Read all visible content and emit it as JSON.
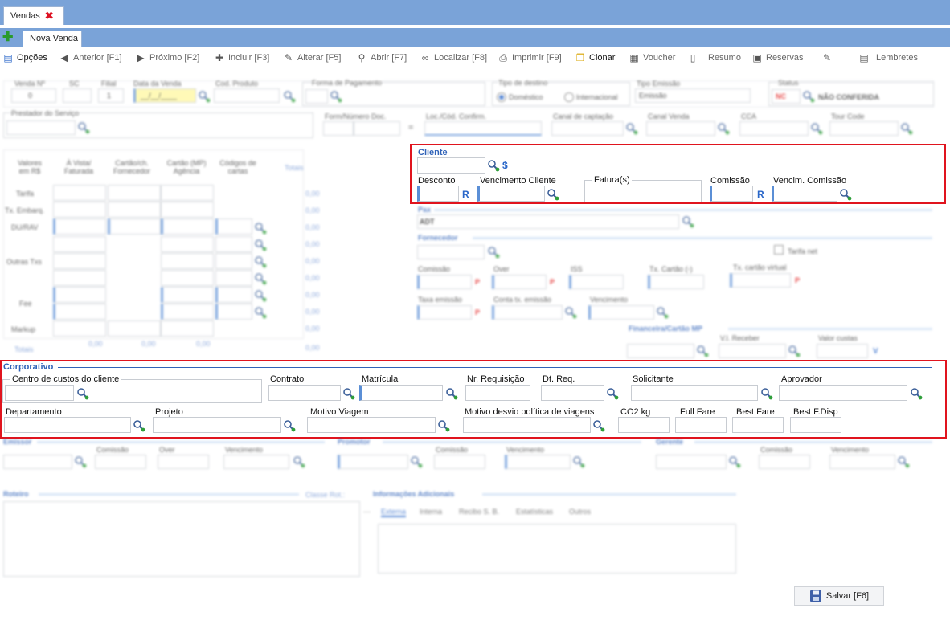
{
  "tabs": {
    "main": "Vendas",
    "sub": "Nova Venda"
  },
  "toolbar": {
    "opcoes": "Opções",
    "anterior": "Anterior [F1]",
    "proximo": "Próximo [F2]",
    "incluir": "Incluir [F3]",
    "alterar": "Alterar [F5]",
    "abrir": "Abrir [F7]",
    "localizar": "Localizar [F8]",
    "imprimir": "Imprimir [F9]",
    "clonar": "Clonar",
    "voucher": "Voucher",
    "resumo": "Resumo",
    "reservas": "Reservas",
    "lembretes": "Lembretes"
  },
  "header": {
    "venda_n": "Venda Nº",
    "venda_n_val": "0",
    "sc": "SC",
    "filial": "Filial",
    "filial_val": "1",
    "data_venda": "Data da Venda",
    "data_venda_val": "__/__/____",
    "cod_produto": "Cod. Produto",
    "forma_pagamento": "Forma de Pagamento",
    "tipo_destino": "Tipo de destino",
    "domestico": "Doméstico",
    "internacional": "Internacional",
    "tipo_emissao": "Tipo Emissão",
    "tipo_emissao_val": "Emissão",
    "status": "Status",
    "status_code": "NC",
    "status_val": "NÃO CONFERIDA",
    "prestador": "Prestador do Serviço",
    "form_numero_doc": "Form/Número Doc.",
    "loc_cod": "Loc./Cód. Confirm.",
    "canal_captacao": "Canal de captação",
    "canal_venda": "Canal Venda",
    "cca": "CCA",
    "tour_code": "Tour Code"
  },
  "valores": {
    "col1": "Valores em R$",
    "col2": "À Vista/ Faturada",
    "col3": "Cartão/ch. Fornecedor",
    "col4": "Cartão (MP) Agência",
    "col5": "Códigos de cartas",
    "totais": "Totais",
    "rows": [
      "Tarifa",
      "Tx. Embarq.",
      "DU/RAV",
      "Outras Txs",
      "Fee",
      "Markup"
    ],
    "row_totais": "Totais",
    "zero": "0,00",
    "totais_vals": [
      "0,00",
      "0,00",
      "0,00"
    ]
  },
  "cliente": {
    "title": "Cliente",
    "desconto": "Desconto",
    "vencimento_cliente": "Vencimento Cliente",
    "faturas": "Fatura(s)",
    "comissao": "Comissão",
    "vencim_comissao": "Vencim. Comissão",
    "letter_r": "R",
    "dollar": "$"
  },
  "pax": {
    "title": "Pax",
    "value": "ADT"
  },
  "fornecedor": {
    "title": "Fornecedor",
    "tarifa_net": "Tarifa net",
    "comissao": "Comissão",
    "over": "Over",
    "iss": "ISS",
    "tx_cartao": "Tx. Cartão (-)",
    "tx_cartao_virtual": "Tx. cartão virtual",
    "taxa_emissao": "Taxa emissão",
    "conta_tx": "Conta tx. emissão",
    "vencimento": "Vencimento",
    "letter_p": "P"
  },
  "financeira": {
    "title": "Financeira/Cartão MP",
    "vl_receber": "V.l. Receber",
    "valor_custas": "Valor custas",
    "letter_v": "V"
  },
  "corporativo": {
    "title": "Corporativo",
    "centro_custos": "Centro de custos do cliente",
    "contrato": "Contrato",
    "matricula": "Matrícula",
    "nr_requisicao": "Nr. Requisição",
    "dt_req": "Dt. Req.",
    "solicitante": "Solicitante",
    "aprovador": "Aprovador",
    "departamento": "Departamento",
    "projeto": "Projeto",
    "motivo_viagem": "Motivo Viagem",
    "motivo_desvio": "Motivo desvio política de viagens",
    "co2": "CO2 kg",
    "full_fare": "Full Fare",
    "best_fare": "Best Fare",
    "best_fdisp": "Best F.Disp"
  },
  "emissor": {
    "title": "Emissor",
    "comissao": "Comissão",
    "over": "Over",
    "vencimento": "Vencimento"
  },
  "promotor": {
    "title": "Promotor",
    "comissao": "Comissão",
    "vencimento": "Vencimento"
  },
  "gerente": {
    "title": "Gerente",
    "comissao": "Comissão",
    "vencimento": "Vencimento"
  },
  "roteiro": {
    "title": "Roteiro",
    "classe": "Classe Rot.:"
  },
  "info": {
    "title": "Informações Adicionais",
    "tabs": [
      "Externa",
      "Interna",
      "Recibo S. B.",
      "Estatísticas",
      "Outros"
    ]
  },
  "save": "Salvar [F6]"
}
